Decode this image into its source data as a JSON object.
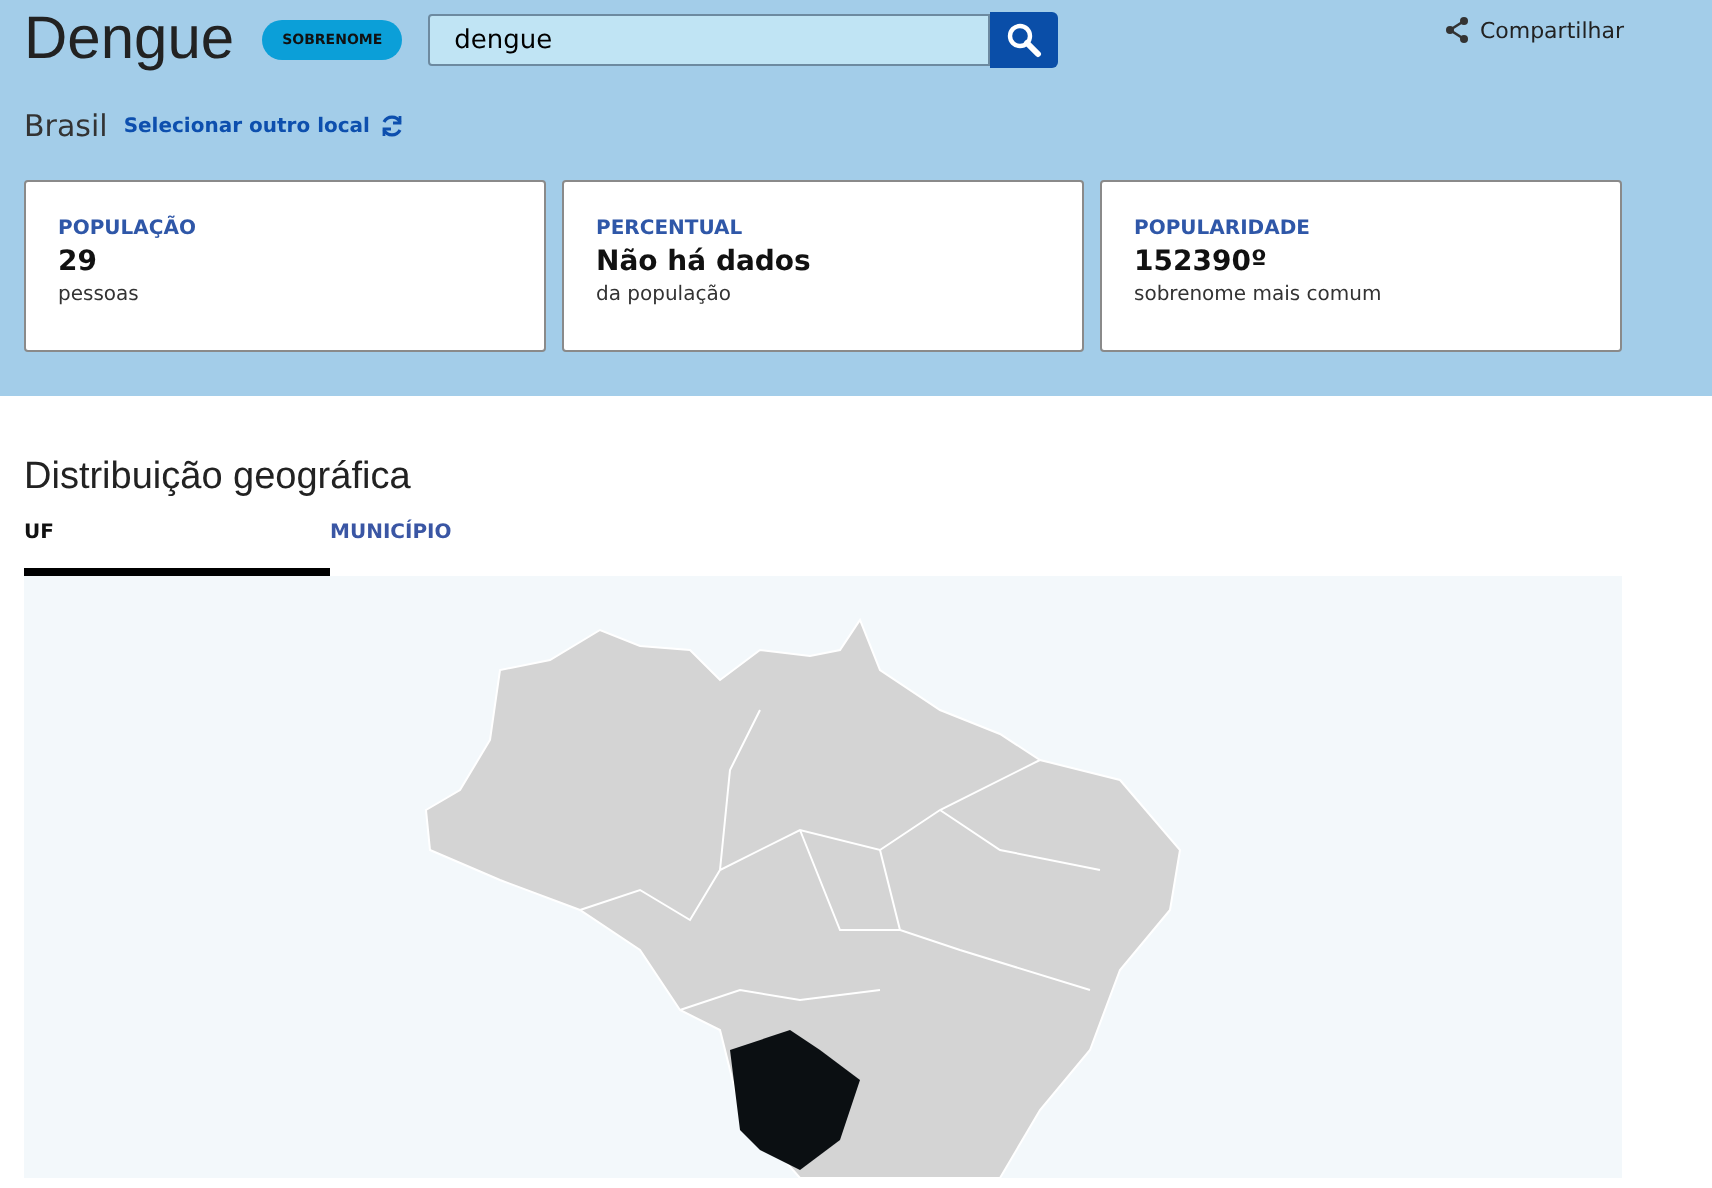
{
  "header": {
    "title": "Dengue",
    "badge": "SOBRENOME",
    "search": {
      "value": "dengue"
    },
    "share": "Compartilhar",
    "location": "Brasil",
    "change_location": "Selecionar outro local"
  },
  "cards": [
    {
      "label": "POPULAÇÃO",
      "value": "29",
      "caption": "pessoas"
    },
    {
      "label": "PERCENTUAL",
      "value": "Não há dados",
      "caption": "da população"
    },
    {
      "label": "POPULARIDADE",
      "value": "152390º",
      "caption": "sobrenome mais comum"
    }
  ],
  "section": {
    "title": "Distribuição geográfica"
  },
  "tabs": [
    {
      "label": "UF",
      "selected": true
    },
    {
      "label": "MUNICÍPIO",
      "selected": false
    }
  ]
}
